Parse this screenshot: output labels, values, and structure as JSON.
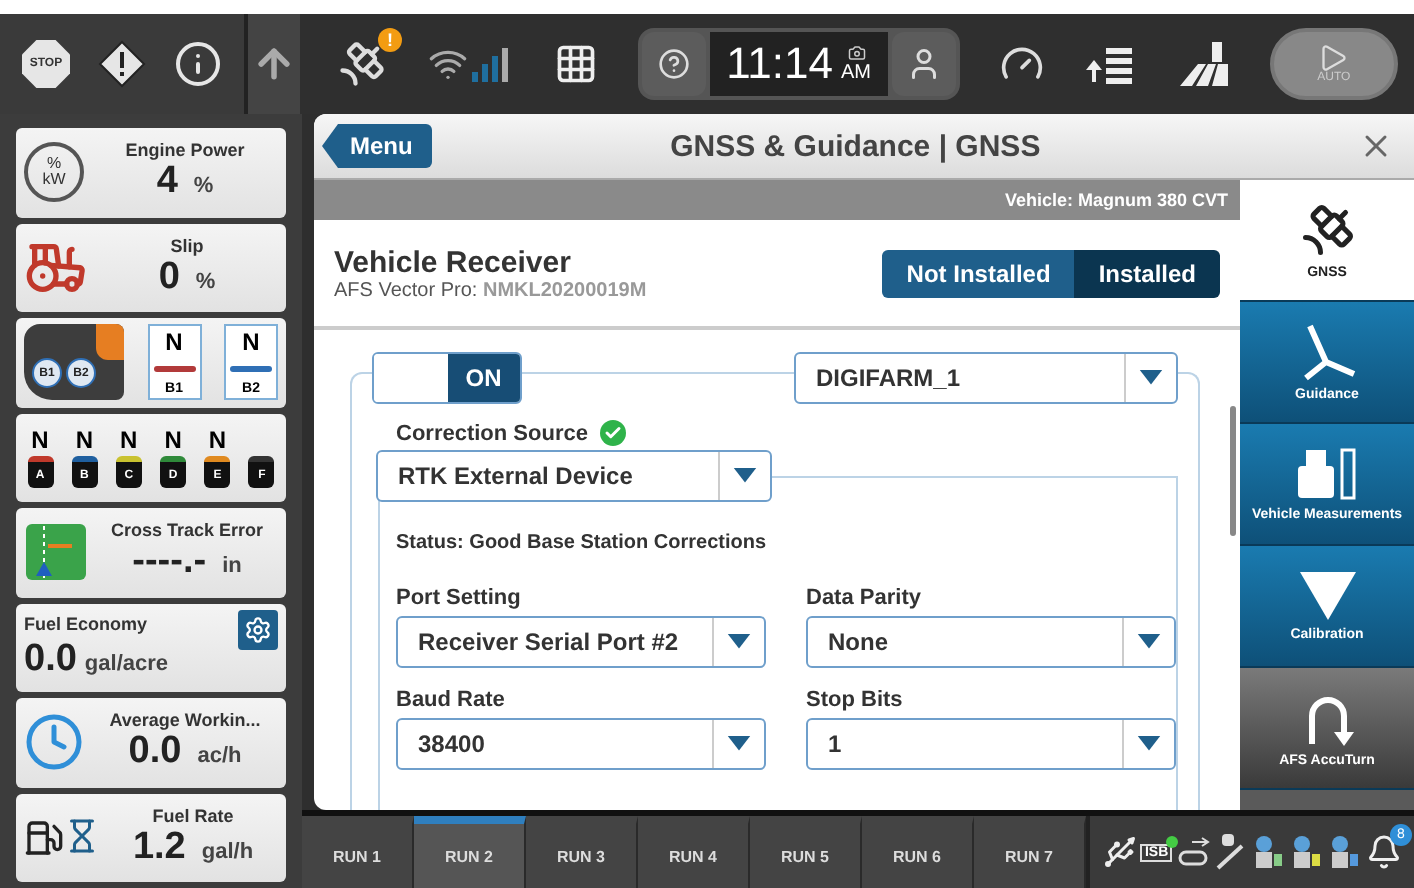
{
  "top_bar": {
    "stop_label": "STOP",
    "satellite_alert": "!",
    "time": "11:14",
    "meridiem": "AM",
    "auto_label": "AUTO"
  },
  "widgets": [
    {
      "kind": "engine",
      "icon_lines": [
        "%",
        "kW"
      ],
      "title": "Engine Power",
      "value": "4",
      "unit": "%"
    },
    {
      "kind": "slip",
      "title": "Slip",
      "value": "0",
      "unit": "%"
    },
    {
      "kind": "sections",
      "joystick_labels": [
        "B1",
        "B2"
      ],
      "sections": [
        {
          "state": "N",
          "label": "B1",
          "color": "#b23a3a"
        },
        {
          "state": "N",
          "label": "B2",
          "color": "#2f6fb5"
        }
      ]
    },
    {
      "kind": "remotes",
      "valves": [
        {
          "state": "N",
          "letter": "A",
          "color": "#c0392b"
        },
        {
          "state": "N",
          "letter": "B",
          "color": "#1f5f9f"
        },
        {
          "state": "N",
          "letter": "C",
          "color": "#c9c230"
        },
        {
          "state": "N",
          "letter": "D",
          "color": "#2f8a3a"
        },
        {
          "state": "N",
          "letter": "E",
          "color": "#e08a20"
        },
        {
          "letter": "F",
          "color": "#333333"
        }
      ]
    },
    {
      "kind": "track",
      "title": "Cross Track Error",
      "value": "----.-",
      "unit": "in"
    },
    {
      "kind": "economy",
      "title": "Fuel Economy",
      "value": "0.0",
      "unit": "gal/acre"
    },
    {
      "kind": "workrate",
      "title": "Average Workin...",
      "value": "0.0",
      "unit": "ac/h"
    },
    {
      "kind": "fuelrate",
      "title": "Fuel Rate",
      "value": "1.2",
      "unit": "gal/h"
    }
  ],
  "dialog": {
    "menu_button": "Menu",
    "title": "GNSS & Guidance | GNSS",
    "vehicle": "Vehicle: Magnum 380 CVT",
    "receiver": {
      "title": "Vehicle Receiver",
      "model": "AFS Vector Pro:",
      "serial": "NMKL20200019M",
      "install_options": [
        {
          "label": "Not Installed",
          "selected": false
        },
        {
          "label": "Installed",
          "selected": true
        }
      ]
    },
    "rtk_toggle": {
      "on": true,
      "label": "ON"
    },
    "configuration": {
      "value": "DIGIFARM_1"
    },
    "correction_source": {
      "label": "Correction Source",
      "ok": true,
      "value": "RTK External Device"
    },
    "status": "Status: Good Base Station Corrections",
    "fields": [
      {
        "label": "Port Setting",
        "value": "Receiver Serial Port #2"
      },
      {
        "label": "Data Parity",
        "value": "None"
      },
      {
        "label": "Baud Rate",
        "value": "38400"
      },
      {
        "label": "Stop Bits",
        "value": "1"
      }
    ]
  },
  "side_nav": [
    {
      "kind": "gnss",
      "label": "GNSS",
      "selected": true
    },
    {
      "kind": "guidance",
      "label": "Guidance",
      "selected": false
    },
    {
      "kind": "measurements",
      "label": "Vehicle Measurements",
      "selected": false
    },
    {
      "kind": "calibration",
      "label": "Calibration",
      "selected": false
    },
    {
      "kind": "accuturn",
      "label": "AFS AccuTurn",
      "selected": false
    }
  ],
  "bottom_bar": {
    "runs": [
      {
        "label": "RUN 1",
        "selected": false
      },
      {
        "label": "RUN 2",
        "selected": true
      },
      {
        "label": "RUN 3",
        "selected": false
      },
      {
        "label": "RUN 4",
        "selected": false
      },
      {
        "label": "RUN 5",
        "selected": false
      },
      {
        "label": "RUN 6",
        "selected": false
      },
      {
        "label": "RUN 7",
        "selected": false
      }
    ],
    "isb_label": "ISB",
    "notifications": "8"
  }
}
